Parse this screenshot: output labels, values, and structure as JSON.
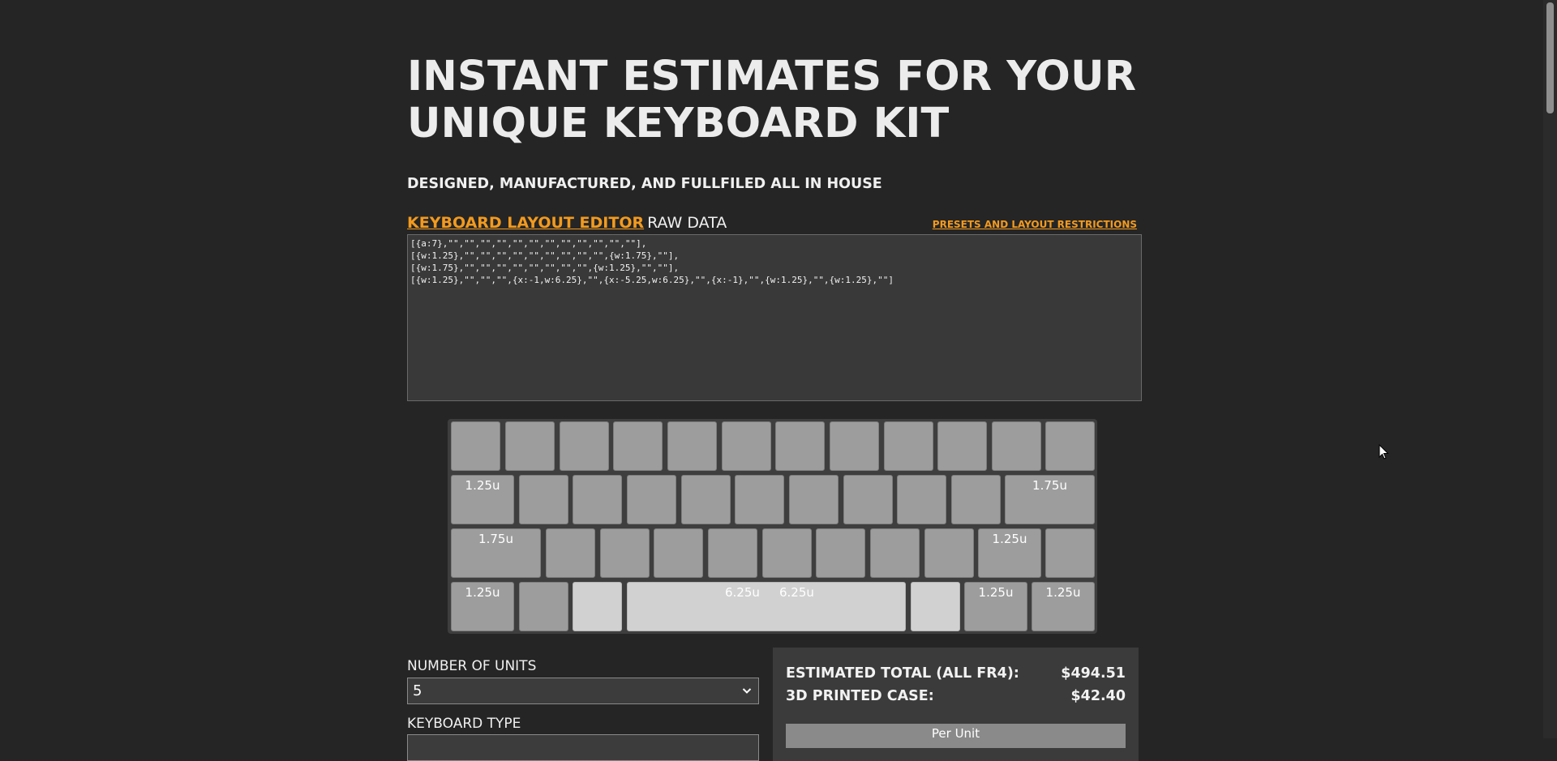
{
  "header": {
    "title_line1": "INSTANT ESTIMATES FOR YOUR",
    "title_line2": "UNIQUE KEYBOARD KIT",
    "subtitle": "DESIGNED, MANUFACTURED, AND FULLFILED ALL IN HOUSE"
  },
  "editor": {
    "link_label": "KEYBOARD LAYOUT EDITOR",
    "raw_label": "RAW DATA",
    "presets_link": "PRESETS AND LAYOUT RESTRICTIONS",
    "raw_data": "[{a:7},\"\",\"\",\"\",\"\",\"\",\"\",\"\",\"\",\"\",\"\",\"\",\"\"],\n[{w:1.25},\"\",\"\",\"\",\"\",\"\",\"\",\"\",\"\",\"\",{w:1.75},\"\"],\n[{w:1.75},\"\",\"\",\"\",\"\",\"\",\"\",\"\",\"\",{w:1.25},\"\",\"\"],\n[{w:1.25},\"\",\"\",\"\",{x:-1,w:6.25},\"\",{x:-5.25,w:6.25},\"\",{x:-1},\"\",{w:1.25},\"\",{w:1.25},\"\"]"
  },
  "keyboard": {
    "key_labels": {
      "w125": "1.25u",
      "w175": "1.75u",
      "w625": "6.25u"
    }
  },
  "form": {
    "units_label": "NUMBER OF UNITS",
    "units_value": "5",
    "type_label": "KEYBOARD TYPE"
  },
  "estimate": {
    "total_label": "ESTIMATED TOTAL (ALL FR4):",
    "total_value": "$494.51",
    "case_label": "3D PRINTED CASE:",
    "case_value": "$42.40",
    "per_unit_label": "Per Unit"
  },
  "icons": {
    "dropdown": "chevron-down-icon",
    "cursor": "mouse-pointer-icon"
  }
}
